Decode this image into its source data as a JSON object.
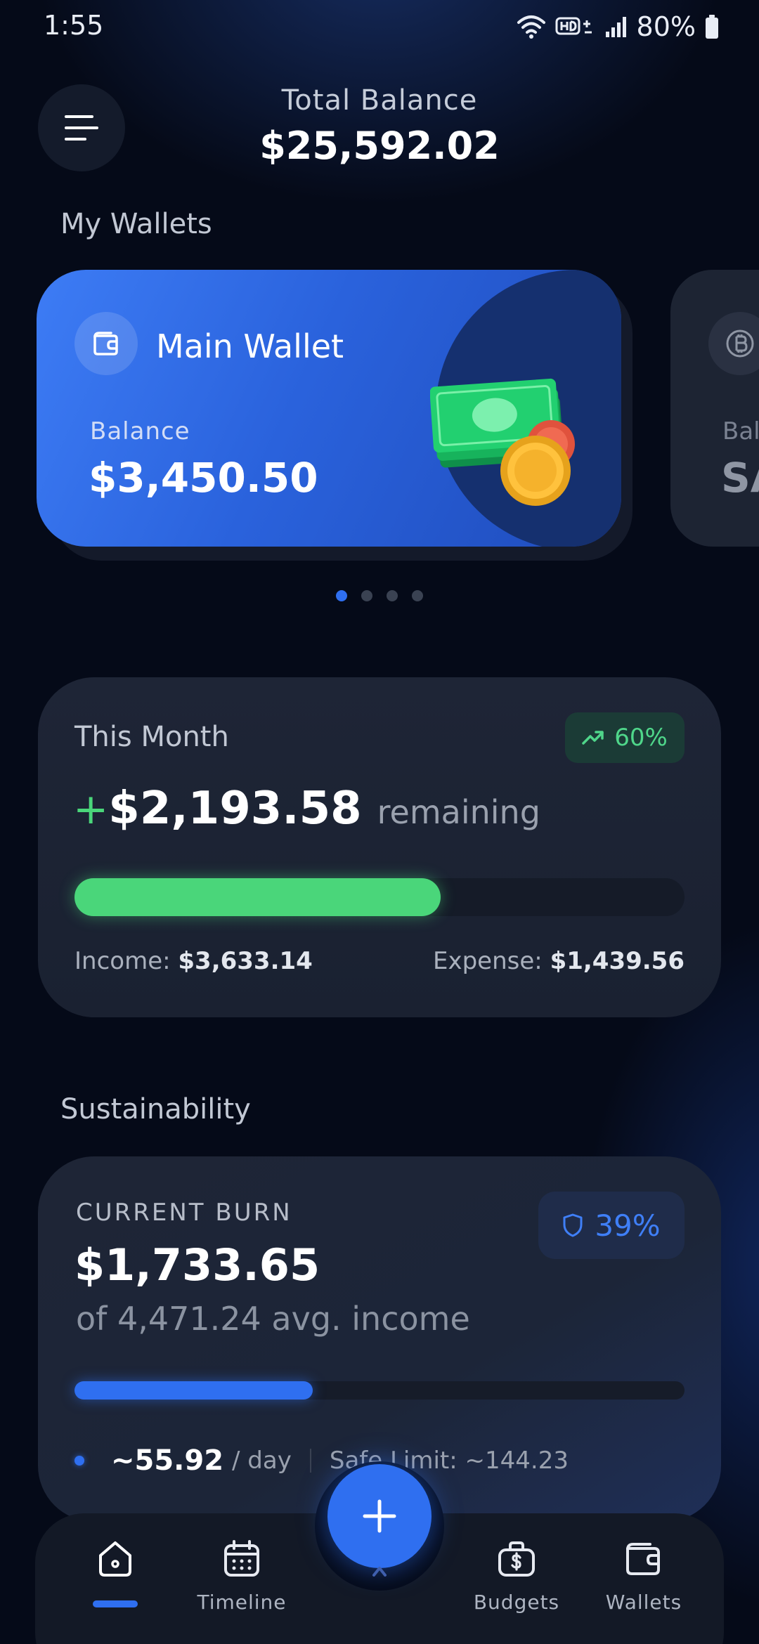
{
  "status_bar": {
    "time": "1:55",
    "battery": "80%"
  },
  "header": {
    "label": "Total Balance",
    "amount": "$25,592.02"
  },
  "wallets": {
    "section_title": "My Wallets",
    "main": {
      "name": "Main Wallet",
      "balance_label": "Balance",
      "balance": "$3,450.50"
    },
    "peek": {
      "balance_label": "Bal",
      "balance": "SA"
    },
    "pager": {
      "count": 4,
      "active_index": 0
    }
  },
  "this_month": {
    "title": "This Month",
    "badge": "60%",
    "plus": "+",
    "amount": "$2,193.58",
    "remaining_label": "remaining",
    "progress": 0.6,
    "income_label": "Income:",
    "income": "$3,633.14",
    "expense_label": "Expense:",
    "expense": "$1,439.56"
  },
  "sustainability": {
    "section_title": "Sustainability",
    "label": "CURRENT BURN",
    "badge": "39%",
    "amount": "$1,733.65",
    "subtitle": "of 4,471.24 avg. income",
    "progress": 0.39,
    "per_day": "~55.92",
    "per_day_unit": "/ day",
    "safe_limit": "Safe Limit: ~144.23"
  },
  "nav": {
    "items": [
      {
        "label": "",
        "icon": "home-icon",
        "active": true
      },
      {
        "label": "Timeline",
        "icon": "calendar-icon"
      },
      {
        "label": "Budgets",
        "icon": "briefcase-dollar-icon"
      },
      {
        "label": "Wallets",
        "icon": "wallet-icon"
      }
    ],
    "fab_icon": "plus-icon"
  },
  "colors": {
    "accent": "#2f6ff0",
    "positive": "#4ad67a",
    "background": "#050a18",
    "card": "#1e2536"
  }
}
